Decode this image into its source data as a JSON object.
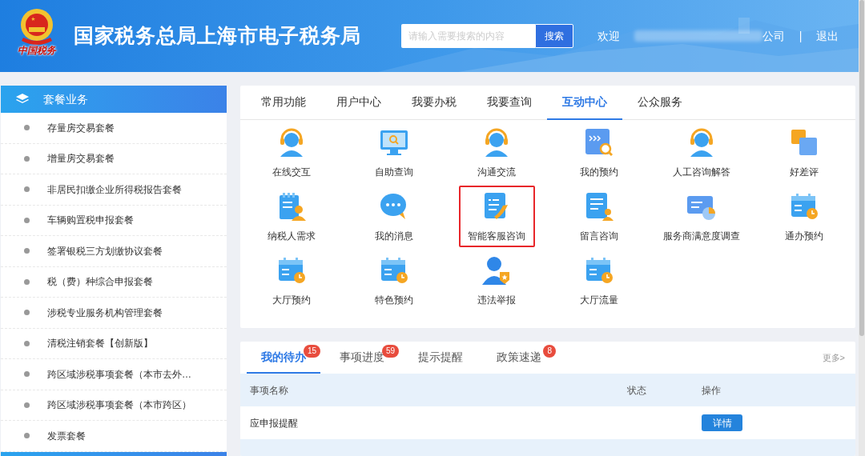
{
  "header": {
    "emblem_text": "中国税务",
    "title": "国家税务总局上海市电子税务局",
    "search": {
      "placeholder": "请输入需要搜索的内容",
      "button": "搜索"
    },
    "welcome": "欢迎",
    "company_suffix": "公司",
    "separator": "|",
    "logout": "退出"
  },
  "sidebar": {
    "title": "套餐业务",
    "items": [
      {
        "label": "存量房交易套餐"
      },
      {
        "label": "增量房交易套餐"
      },
      {
        "label": "非居民扣缴企业所得税报告套餐"
      },
      {
        "label": "车辆购置税申报套餐"
      },
      {
        "label": "签署银税三方划缴协议套餐"
      },
      {
        "label": "税（费）种综合申报套餐"
      },
      {
        "label": "涉税专业服务机构管理套餐"
      },
      {
        "label": "清税注销套餐【创新版】"
      },
      {
        "label": "跨区域涉税事项套餐（本市去外…"
      },
      {
        "label": "跨区域涉税事项套餐（本市跨区）"
      },
      {
        "label": "发票套餐"
      }
    ]
  },
  "tabs": [
    {
      "label": "常用功能",
      "selected": false
    },
    {
      "label": "用户中心",
      "selected": false
    },
    {
      "label": "我要办税",
      "selected": false
    },
    {
      "label": "我要查询",
      "selected": false
    },
    {
      "label": "互动中心",
      "selected": true
    },
    {
      "label": "公众服务",
      "selected": false
    }
  ],
  "services": [
    {
      "label": "在线交互",
      "highlighted": false
    },
    {
      "label": "自助查询",
      "highlighted": false
    },
    {
      "label": "沟通交流",
      "highlighted": false
    },
    {
      "label": "我的预约",
      "highlighted": false
    },
    {
      "label": "人工咨询解答",
      "highlighted": false
    },
    {
      "label": "好差评",
      "highlighted": false
    },
    {
      "label": "纳税人需求",
      "highlighted": false
    },
    {
      "label": "我的消息",
      "highlighted": false
    },
    {
      "label": "智能客服咨询",
      "highlighted": true
    },
    {
      "label": "留言咨询",
      "highlighted": false
    },
    {
      "label": "服务商满意度调查",
      "highlighted": false
    },
    {
      "label": "通办预约",
      "highlighted": false
    },
    {
      "label": "大厅预约",
      "highlighted": false
    },
    {
      "label": "特色预约",
      "highlighted": false
    },
    {
      "label": "违法举报",
      "highlighted": false
    },
    {
      "label": "大厅流量",
      "highlighted": false
    }
  ],
  "tasks": {
    "tabs": [
      {
        "label": "我的待办",
        "badge": "15",
        "selected": true
      },
      {
        "label": "事项进度",
        "badge": "59",
        "selected": false
      },
      {
        "label": "提示提醒",
        "selected": false
      },
      {
        "label": "政策速递",
        "badge": "8",
        "selected": false
      }
    ],
    "more": "更多>",
    "columns": [
      "事项名称",
      "状态",
      "操作"
    ],
    "rows": [
      {
        "name": "应申报提醒",
        "action": "详情"
      }
    ]
  }
}
